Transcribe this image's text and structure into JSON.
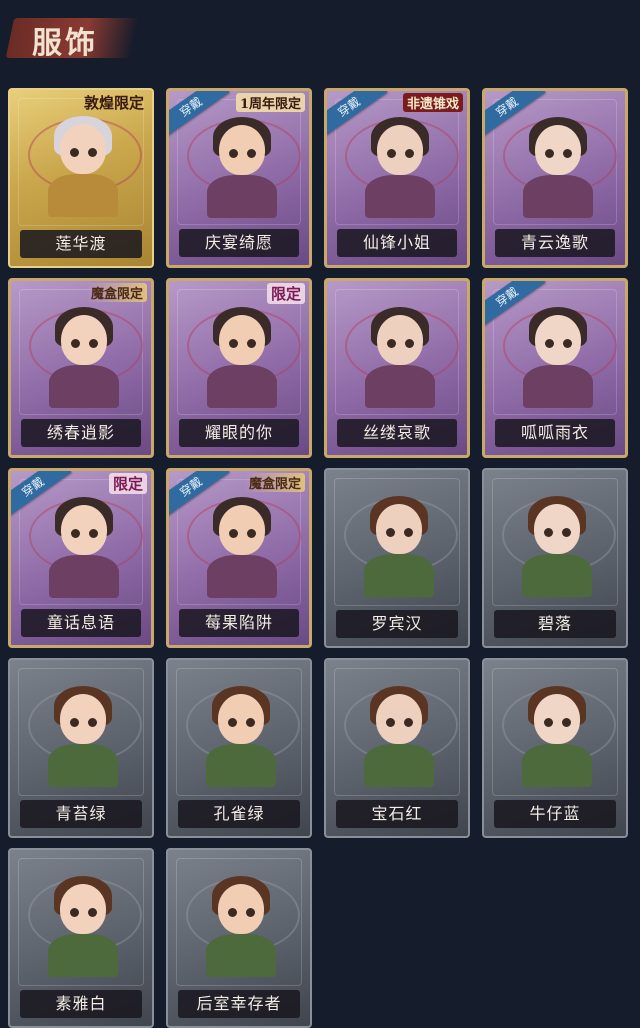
{
  "header": {
    "title": "服饰"
  },
  "labels": {
    "wear": "穿戴"
  },
  "tags": {
    "dunhuang": "敦煌限定",
    "anniv": "1周年限定",
    "heritage": "非遗锥戏",
    "boxlimit": "魔盒限定",
    "limit": "限定"
  },
  "costumes": [
    {
      "name": "莲华渡",
      "tier": "gold",
      "wear": false,
      "tag": "dunhuang"
    },
    {
      "name": "庆宴绮愿",
      "tier": "purple",
      "wear": true,
      "tag": "anniv"
    },
    {
      "name": "仙锋小姐",
      "tier": "purple",
      "wear": true,
      "tag": "heritage"
    },
    {
      "name": "青云逸歌",
      "tier": "purple",
      "wear": true,
      "tag": ""
    },
    {
      "name": "绣春逍影",
      "tier": "purple",
      "wear": false,
      "tag": "boxlimit"
    },
    {
      "name": "耀眼的你",
      "tier": "purple",
      "wear": false,
      "tag": "limit"
    },
    {
      "name": "丝缕哀歌",
      "tier": "purple",
      "wear": false,
      "tag": ""
    },
    {
      "name": "呱呱雨衣",
      "tier": "purple",
      "wear": true,
      "tag": ""
    },
    {
      "name": "童话息语",
      "tier": "purple",
      "wear": true,
      "tag": "limit"
    },
    {
      "name": "莓果陷阱",
      "tier": "purple",
      "wear": true,
      "tag": "boxlimit"
    },
    {
      "name": "罗宾汉",
      "tier": "gray",
      "wear": false,
      "tag": ""
    },
    {
      "name": "碧落",
      "tier": "gray",
      "wear": false,
      "tag": ""
    },
    {
      "name": "青苔绿",
      "tier": "gray",
      "wear": false,
      "tag": ""
    },
    {
      "name": "孔雀绿",
      "tier": "gray",
      "wear": false,
      "tag": ""
    },
    {
      "name": "宝石红",
      "tier": "gray",
      "wear": false,
      "tag": ""
    },
    {
      "name": "牛仔蓝",
      "tier": "gray",
      "wear": false,
      "tag": ""
    },
    {
      "name": "素雅白",
      "tier": "gray",
      "wear": false,
      "tag": ""
    },
    {
      "name": "后室幸存者",
      "tier": "gray",
      "wear": false,
      "tag": ""
    }
  ],
  "colors": {
    "background": "#151c2b",
    "gold": "#d7b65c",
    "purple": "#8e6aa6",
    "gray": "#5c626c",
    "wear_badge": "#2f6aa0"
  }
}
